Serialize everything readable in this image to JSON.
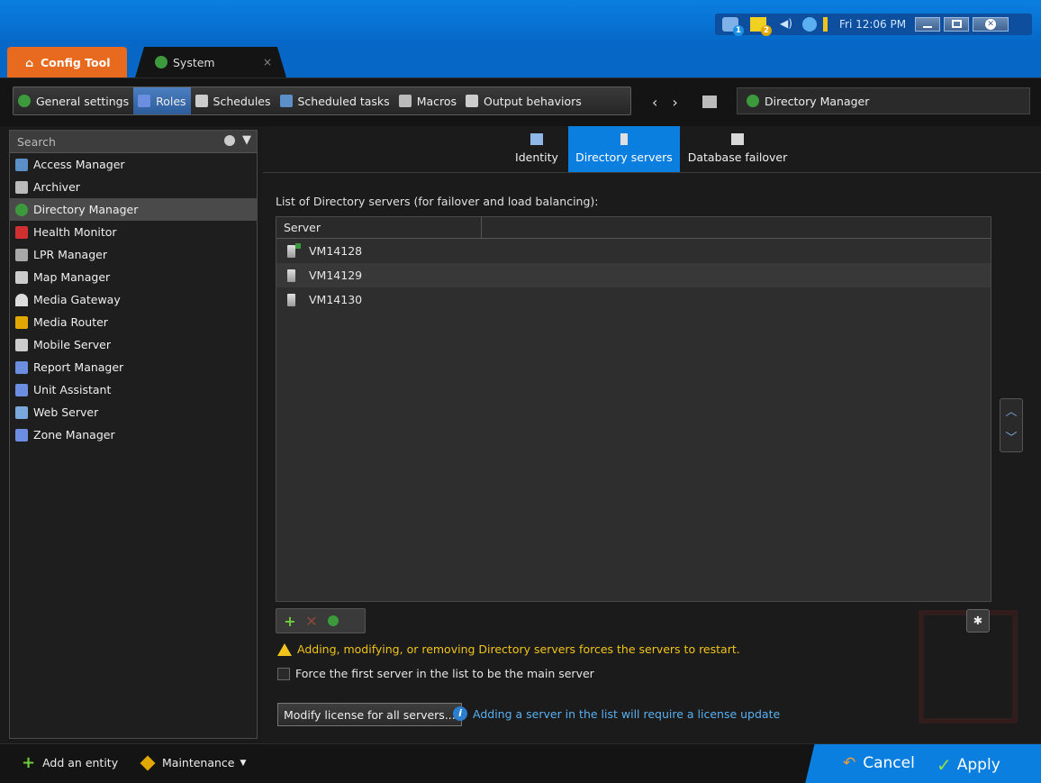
{
  "tray": {
    "clock": "Fri 12:06 PM",
    "badge1": "1",
    "badge2": "2"
  },
  "tabs": {
    "config_tool": "Config Tool",
    "system": "System",
    "close": "×"
  },
  "toolbar": {
    "tasks": [
      "General settings",
      "Roles",
      "Schedules",
      "Scheduled tasks",
      "Macros",
      "Output behaviors"
    ],
    "location": "Directory Manager"
  },
  "sidebar": {
    "search_placeholder": "Search",
    "entities": [
      "Access Manager",
      "Archiver",
      "Directory Manager",
      "Health Monitor",
      "LPR Manager",
      "Map Manager",
      "Media Gateway",
      "Media Router",
      "Mobile Server",
      "Report Manager",
      "Unit Assistant",
      "Web Server",
      "Zone Manager"
    ]
  },
  "subtabs": [
    "Identity",
    "Directory servers",
    "Database failover"
  ],
  "content": {
    "list_label": "List of Directory servers (for failover and load balancing):",
    "column_server": "Server",
    "servers": [
      "VM14128",
      "VM14129",
      "VM14130"
    ],
    "warning": "Adding, modifying, or removing Directory servers forces the servers to restart.",
    "force_label": "Force the first server in the list to be the main server",
    "modify_button": "Modify license for all servers...",
    "license_info": "Adding a server in the list will require a license update"
  },
  "bottom": {
    "add_entity": "Add an entity",
    "maintenance": "Maintenance",
    "cancel": "Cancel",
    "apply": "Apply"
  },
  "colors": {
    "accent": "#0a7fe0",
    "config_tab": "#e86a1e",
    "warning": "#f0c41b",
    "link": "#5ab0f0"
  }
}
